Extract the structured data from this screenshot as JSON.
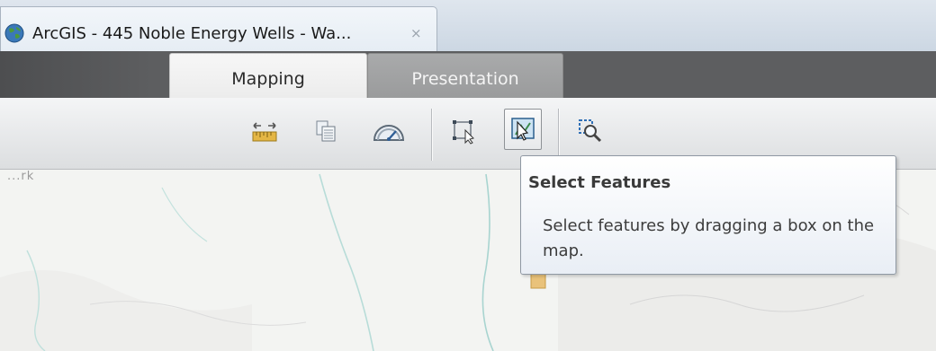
{
  "browser": {
    "tab_title": "ArcGIS - 445 Noble Energy Wells - Wa...",
    "close_glyph": "×"
  },
  "ribbon": {
    "tabs": [
      {
        "label": "Mapping",
        "active": true
      },
      {
        "label": "Presentation",
        "active": false
      }
    ]
  },
  "toolbar": {
    "buttons": [
      {
        "icon": "measure-icon"
      },
      {
        "icon": "attribute-table-icon"
      },
      {
        "icon": "gauge-icon"
      },
      {
        "icon": "select-box-icon"
      },
      {
        "icon": "select-features-icon",
        "active": true
      },
      {
        "icon": "zoom-to-selection-icon"
      }
    ]
  },
  "map": {
    "label": "...rk"
  },
  "tooltip": {
    "title": "Select Features",
    "body": "Select features by dragging a box on the map."
  },
  "colors": {
    "ribbon_dark": "#5d5e60",
    "inactive_tab": "#a9aaab",
    "tooltip_border": "#8f98a3",
    "river": "#a8d4d0"
  }
}
